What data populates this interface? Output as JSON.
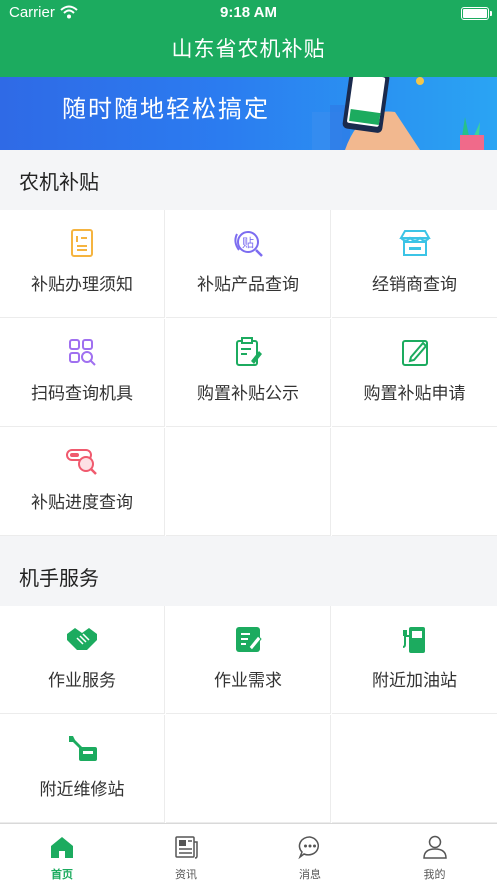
{
  "status_bar": {
    "carrier": "Carrier",
    "time": "9:18 AM"
  },
  "header": {
    "title": "山东省农机补贴"
  },
  "banner": {
    "text": "随时随地轻松搞定"
  },
  "sections": [
    {
      "title": "农机补贴",
      "items": [
        {
          "label": "补贴办理须知",
          "icon": "notice-document-icon",
          "color": "#f5b440"
        },
        {
          "label": "补贴产品查询",
          "icon": "subsidy-search-icon",
          "color": "#7c6cf0"
        },
        {
          "label": "经销商查询",
          "icon": "shop-icon",
          "color": "#3cc4e6"
        },
        {
          "label": "扫码查询机具",
          "icon": "scan-grid-icon",
          "color": "#a070f0"
        },
        {
          "label": "购置补贴公示",
          "icon": "clipboard-edit-icon",
          "color": "#1cab5f"
        },
        {
          "label": "购置补贴申请",
          "icon": "edit-form-icon",
          "color": "#1cab5f"
        },
        {
          "label": "补贴进度查询",
          "icon": "progress-search-icon",
          "color": "#f05a6e"
        }
      ]
    },
    {
      "title": "机手服务",
      "items": [
        {
          "label": "作业服务",
          "icon": "handshake-icon",
          "color": "#1cab5f"
        },
        {
          "label": "作业需求",
          "icon": "demand-form-icon",
          "color": "#1cab5f"
        },
        {
          "label": "附近加油站",
          "icon": "gas-station-icon",
          "color": "#1cab5f"
        },
        {
          "label": "附近维修站",
          "icon": "wrench-repair-icon",
          "color": "#1cab5f"
        }
      ]
    }
  ],
  "tabs": [
    {
      "label": "首页",
      "icon": "home-icon",
      "active": true
    },
    {
      "label": "资讯",
      "icon": "news-icon",
      "active": false
    },
    {
      "label": "消息",
      "icon": "message-icon",
      "active": false
    },
    {
      "label": "我的",
      "icon": "profile-icon",
      "active": false
    }
  ],
  "colors": {
    "primary": "#1cab5f",
    "banner_start": "#2f6ae6",
    "banner_end": "#2aa4f3",
    "inactive_tab": "#555555"
  }
}
